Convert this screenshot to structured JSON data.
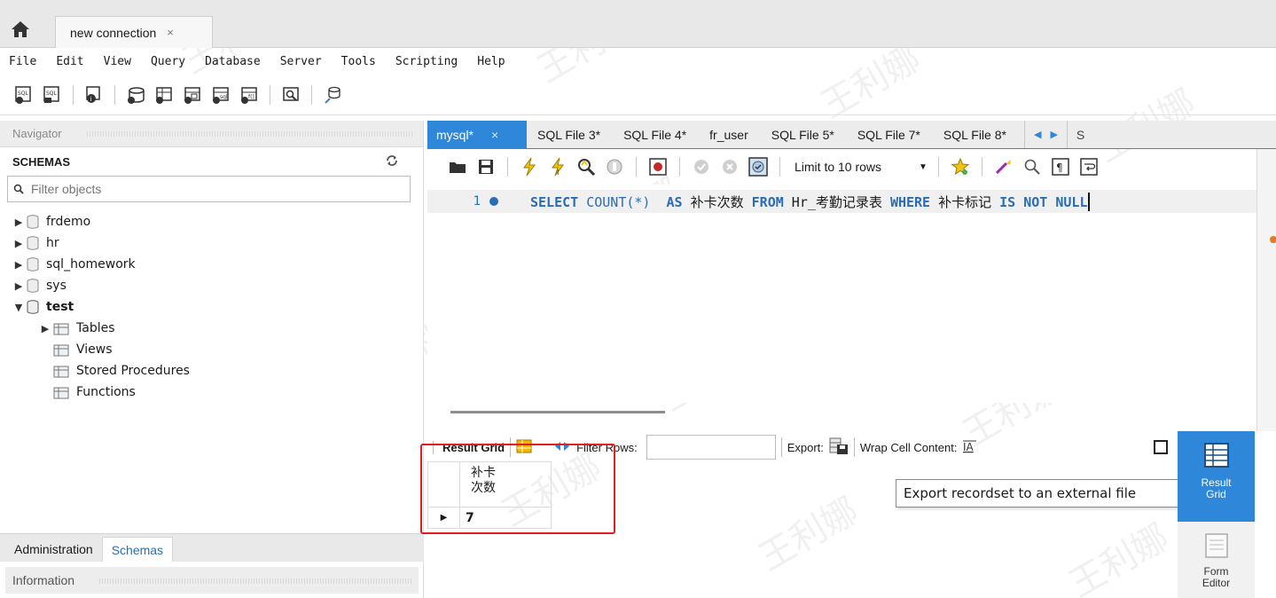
{
  "connection_tab": {
    "label": "new connection",
    "close": "×"
  },
  "menu": [
    "File",
    "Edit",
    "View",
    "Query",
    "Database",
    "Server",
    "Tools",
    "Scripting",
    "Help"
  ],
  "navigator": {
    "header": "Navigator",
    "schemas_title": "SCHEMAS",
    "filter_placeholder": "Filter objects",
    "schemas": [
      {
        "name": "frdemo",
        "expanded": false
      },
      {
        "name": "hr",
        "expanded": false
      },
      {
        "name": "sql_homework",
        "expanded": false
      },
      {
        "name": "sys",
        "expanded": false
      },
      {
        "name": "test",
        "expanded": true
      }
    ],
    "test_children": [
      "Tables",
      "Views",
      "Stored Procedures",
      "Functions"
    ],
    "bottom_tabs": [
      "Administration",
      "Schemas"
    ],
    "info_header": "Information"
  },
  "editor_tabs": [
    "mysql*",
    "SQL File 3*",
    "SQL File 4*",
    "fr_user",
    "SQL File 5*",
    "SQL File 7*",
    "SQL File 8*"
  ],
  "editor_tab_close": "×",
  "side_label": "S",
  "limit_rows": "Limit to 10 rows",
  "code": {
    "line_number": "1",
    "tokens": [
      {
        "t": "SELECT",
        "k": "kw"
      },
      {
        "t": " ",
        "k": ""
      },
      {
        "t": "COUNT(*)",
        "k": "fn"
      },
      {
        "t": "  ",
        "k": ""
      },
      {
        "t": "AS",
        "k": "kw"
      },
      {
        "t": " 补卡次数 ",
        "k": ""
      },
      {
        "t": "FROM",
        "k": "kw"
      },
      {
        "t": " Hr_考勤记录表 ",
        "k": ""
      },
      {
        "t": "WHERE",
        "k": "kw"
      },
      {
        "t": " 补卡标记 ",
        "k": ""
      },
      {
        "t": "IS NOT NULL",
        "k": "kw"
      }
    ]
  },
  "result_toolbar": {
    "result_grid": "Result Grid",
    "filter_rows": "Filter Rows:",
    "export": "Export:",
    "wrap": "Wrap Cell Content:"
  },
  "result": {
    "column_line1": "补卡",
    "column_line2": "次数",
    "value": "7"
  },
  "tooltip": "Export recordset to an external file",
  "side_panel": {
    "result_line1": "Result",
    "result_line2": "Grid",
    "form_line1": "Form",
    "form_line2": "Editor"
  },
  "watermark": "王利娜",
  "colors": {
    "accent": "#2e87d8",
    "keyword": "#2b6cb6",
    "highlight": "#e11d1d"
  }
}
